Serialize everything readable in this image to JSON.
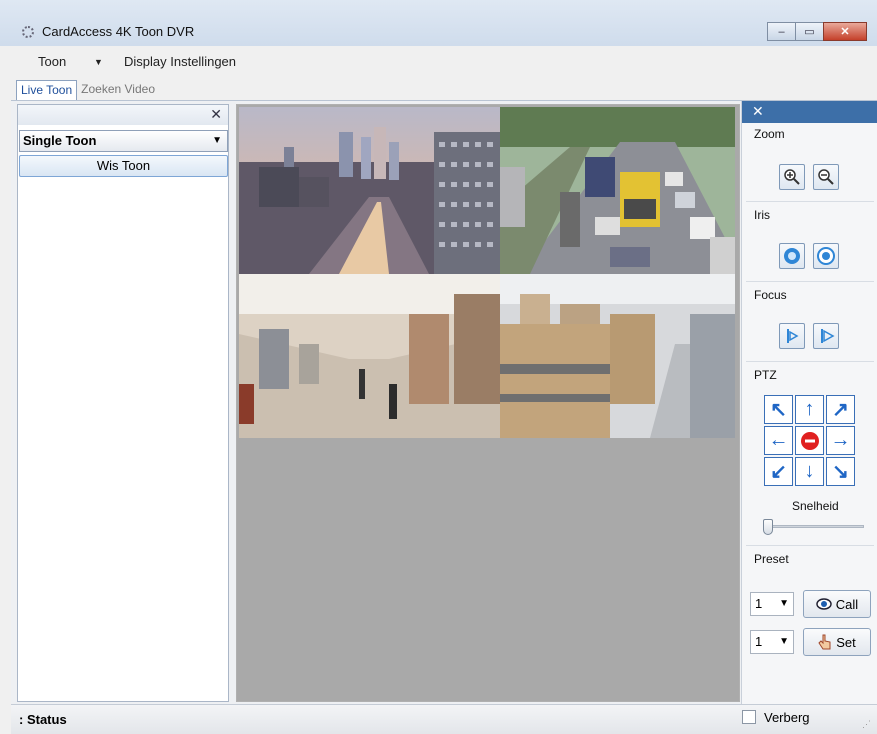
{
  "window": {
    "title": "CardAccess 4K Toon DVR",
    "controls": {
      "minimize": "–",
      "maximize": "▭",
      "close": "✕"
    }
  },
  "menu": {
    "items": [
      {
        "label": "Toon",
        "has_dropdown": true
      },
      {
        "label": "Display Instellingen",
        "has_dropdown": false
      }
    ]
  },
  "tabs": [
    {
      "label": "Live Toon",
      "active": true
    },
    {
      "label": "Zoeken Video",
      "active": false
    }
  ],
  "left_panel": {
    "close": "✕",
    "mode_select": "Single Toon",
    "clear_button": "Wis Toon"
  },
  "cameras": [
    {
      "scene": "city-skyline"
    },
    {
      "scene": "highway-traffic"
    },
    {
      "scene": "shopping-mall"
    },
    {
      "scene": "warehouse"
    }
  ],
  "right_panel": {
    "close": "✕",
    "zoom": {
      "label": "Zoom",
      "in_icon": "zoom-in-icon",
      "out_icon": "zoom-out-icon"
    },
    "iris": {
      "label": "Iris",
      "open_icon": "iris-open-icon",
      "close_icon": "iris-close-icon"
    },
    "focus": {
      "label": "Focus",
      "near_icon": "focus-near-icon",
      "far_icon": "focus-far-icon"
    },
    "ptz": {
      "label": "PTZ",
      "buttons": [
        "↖",
        "↑",
        "↗",
        "←",
        "stop",
        "→",
        "↙",
        "↓",
        "↘"
      ],
      "speed_label": "Snelheid",
      "speed_value": 0
    },
    "preset": {
      "label": "Preset",
      "call_value": "1",
      "set_value": "1",
      "call_button": "Call",
      "set_button": "Set"
    }
  },
  "status": {
    "label": ": Status",
    "hide_label": "Verberg",
    "hide_checked": false
  },
  "colors": {
    "panel_header": "#3d6fa8",
    "ptz_arrow": "#1f66c5",
    "ptz_stop": "#e02020"
  }
}
